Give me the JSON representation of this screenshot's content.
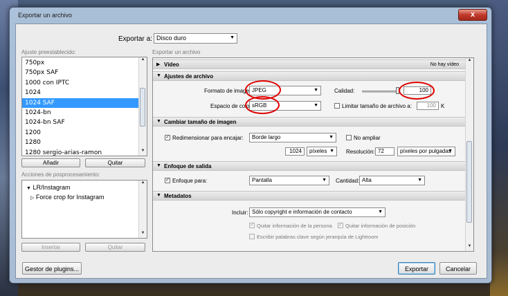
{
  "window": {
    "title": "Exportar un archivo",
    "close_glyph": "x"
  },
  "export_to": {
    "label": "Exportar a:",
    "value": "Disco duro"
  },
  "presets": {
    "label": "Ajuste preestablecido:",
    "items": [
      "750px",
      "750px SAF",
      "1000 con IPTC",
      "1024",
      "1024 SAF",
      "1024-bn",
      "1024-bn SAF",
      "1200",
      "1280",
      "1280 sergio-arias-ramon"
    ],
    "selected_index": 4,
    "add_button": "Añadir",
    "remove_button": "Quitar"
  },
  "post_processing": {
    "label": "Acciones de posprocesamiento:",
    "tree": [
      {
        "glyph": "▼",
        "label": "LR/Instagram"
      },
      {
        "glyph": "▷",
        "label": "Force crop for Instagram"
      }
    ],
    "insert_button": "Insertar",
    "remove_button": "Quitar"
  },
  "export_file_label": "Exportar un archivo",
  "sections": {
    "video": {
      "title": "Vídeo",
      "summary": "No hay vídeo"
    },
    "file_settings": {
      "title": "Ajustes de archivo",
      "format_label": "Formato de imagen:",
      "format_value": "JPEG",
      "quality_label": "Calidad:",
      "quality_value": "100",
      "quality_fraction": 1.0,
      "color_space_label": "Espacio de color:",
      "color_space_value": "sRGB",
      "limit_label": "Limitar tamaño de archivo a:",
      "limit_value": "100",
      "limit_unit": "K"
    },
    "resize": {
      "title": "Cambiar tamaño de imagen",
      "resize_label": "Redimensionar para encajar:",
      "resize_value": "Borde largo",
      "no_enlarge_label": "No ampliar",
      "size_value": "1024",
      "size_unit": "píxeles",
      "resolution_label": "Resolución:",
      "resolution_value": "72",
      "resolution_unit": "píxeles por pulgadas"
    },
    "sharpening": {
      "title": "Enfoque de salida",
      "sharpen_label": "Enfoque para:",
      "sharpen_value": "Pantalla",
      "amount_label": "Cantidad:",
      "amount_value": "Alta"
    },
    "metadata": {
      "title": "Metadatos",
      "include_label": "Incluir:",
      "include_value": "Sólo copyright e información de contacto",
      "remove_person_label": "Quitar información de la persona",
      "remove_location_label": "Quitar información de posición",
      "keywords_label": "Escribir palabras clave según jerarquía de Lightroom"
    }
  },
  "footer": {
    "plugin_manager": "Gestor de plugins...",
    "export": "Exportar",
    "cancel": "Cancelar"
  },
  "annotation_color": "#e00000"
}
